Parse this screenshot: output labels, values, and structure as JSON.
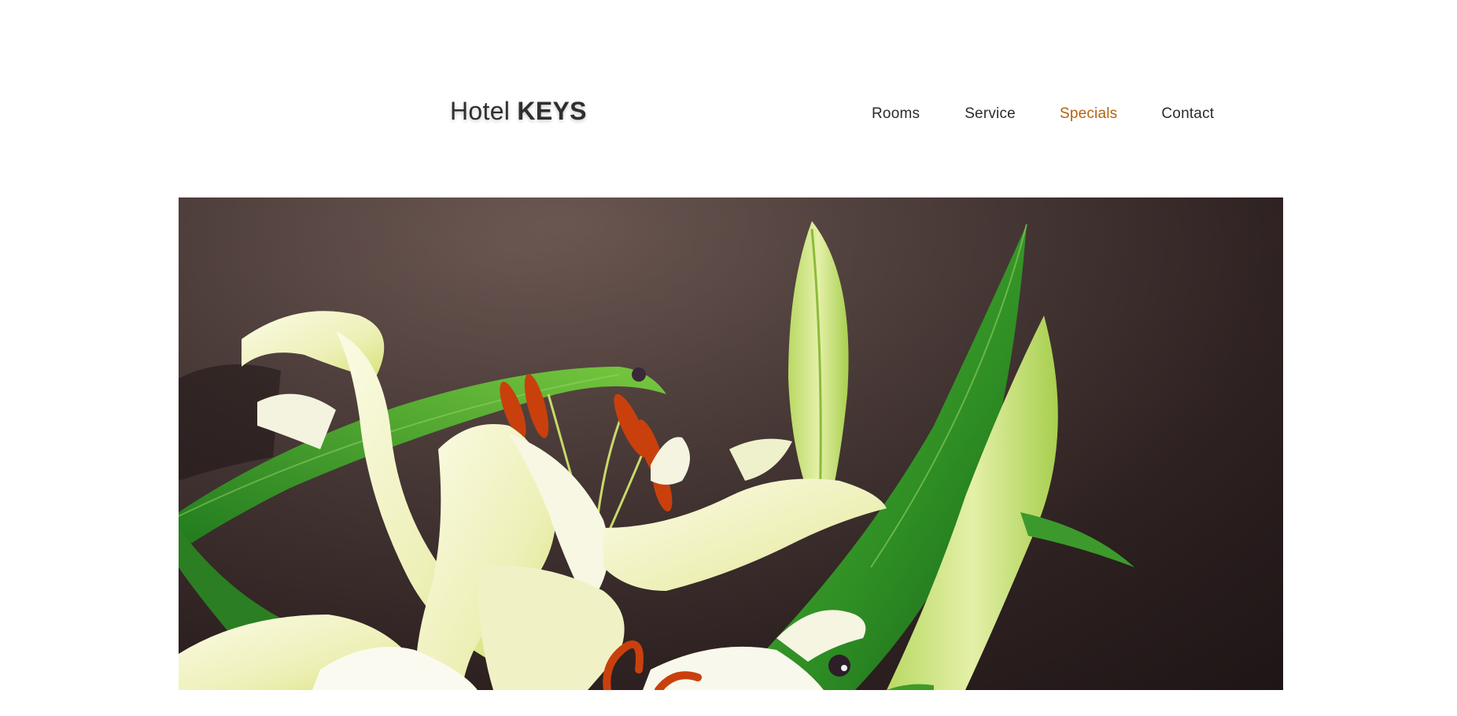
{
  "header": {
    "logo": {
      "light": "Hotel",
      "bold": "KEYS"
    },
    "nav": [
      {
        "label": "Rooms",
        "active": false
      },
      {
        "label": "Service",
        "active": false
      },
      {
        "label": "Specials",
        "active": true
      },
      {
        "label": "Contact",
        "active": false
      }
    ]
  },
  "hero": {
    "image_subject": "white lily flowers with green leaves on dark brown background"
  },
  "colors": {
    "accent": "#b5620f",
    "text": "#2b2b2b",
    "background": "#ffffff"
  }
}
